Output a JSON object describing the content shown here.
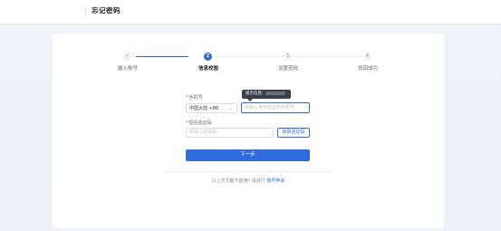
{
  "header": {
    "title": "忘记密码"
  },
  "steps": [
    {
      "number": "✓",
      "label": "输入账号",
      "state": "done"
    },
    {
      "number": "2",
      "label": "信息校验",
      "state": "active"
    },
    {
      "number": "3",
      "label": "设置密码",
      "state": "todo"
    },
    {
      "number": "4",
      "label": "找回成功",
      "state": "todo"
    }
  ],
  "form": {
    "phone_label": "手机号",
    "region_value": "中国大陆 +86",
    "phone_placeholder": "请输入身份验证的手机号",
    "tooltip_text": "提示信息:",
    "code_label": "短信验证码",
    "code_placeholder": "请输入验证码",
    "code_button": "获取验证码",
    "next_button": "下一步"
  },
  "footer": {
    "text": "以上方式都不能用? 请进行",
    "link": "账号申诉"
  },
  "colors": {
    "accent": "#2f6bde",
    "required": "#e04b4b"
  }
}
